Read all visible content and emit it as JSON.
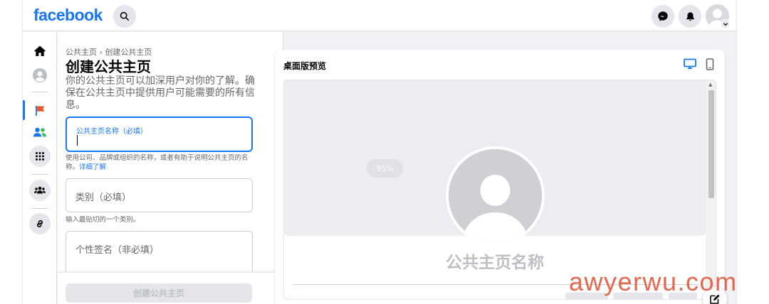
{
  "header": {
    "logo": "facebook",
    "search_icon": "search-icon",
    "messenger_icon": "messenger-icon",
    "notifications_icon": "bell-icon",
    "account_icon": "avatar"
  },
  "sidebar": {
    "items": [
      {
        "icon": "home-icon"
      },
      {
        "icon": "profile-icon"
      },
      {
        "icon": "flag-icon",
        "active": true
      },
      {
        "icon": "friends-icon"
      },
      {
        "icon": "apps-grid-icon"
      },
      {
        "icon": "groups-icon"
      },
      {
        "icon": "link-icon"
      }
    ]
  },
  "form": {
    "breadcrumb": "公共主页 › 创建公共主页",
    "title": "创建公共主页",
    "description": "你的公共主页可以加深用户对你的了解。确保在公共主页中提供用户可能需要的所有信息。",
    "name_field": {
      "label": "公共主页名称（必填）",
      "value": "",
      "hint": "使用公司、品牌或组织的名称，或者有助于说明公共主页的名称。",
      "hint_link": "详细了解"
    },
    "category_field": {
      "placeholder": "类别（必填）",
      "hint": "输入最贴切的一个类别。"
    },
    "bio_field": {
      "placeholder": "个性签名（非必填）"
    },
    "create_button": "创建公共主页"
  },
  "preview": {
    "title": "桌面版预览",
    "desktop_icon": "desktop-icon",
    "mobile_icon": "mobile-icon",
    "progress_label": "95%",
    "page_name_placeholder": "公共主页名称"
  },
  "watermark": "awyerwu.com",
  "colors": {
    "brand": "#1877f2",
    "background": "#f0f2f5",
    "watermark": "#e4573d"
  }
}
